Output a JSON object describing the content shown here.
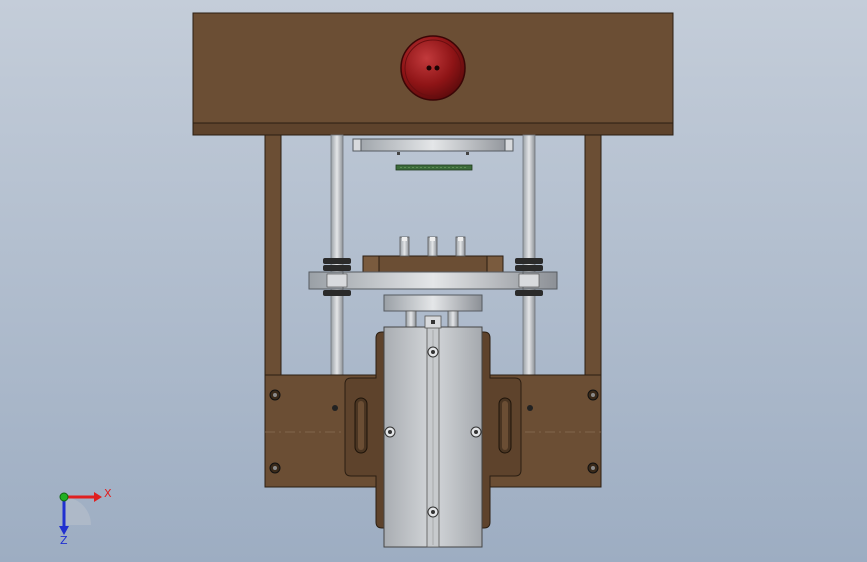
{
  "viewport": {
    "background_top": "#c4cdd9",
    "background_bottom": "#9dadc2"
  },
  "colors": {
    "wood": "#6b4e34",
    "wood_dark": "#4a3522",
    "metal": "#c9ccd0",
    "metal_dark": "#8c9096",
    "knob_red": "#8e1416",
    "pcb_green": "#3c6b3a",
    "axis_x": "#e02020",
    "axis_y": "#22b022",
    "axis_z": "#2030d0"
  },
  "triad": {
    "x_label": "X",
    "z_label": "Z"
  },
  "model": {
    "top_cap": "top-housing",
    "knob": "red-knob",
    "frame": "side-frame",
    "plate": "moving-plate",
    "slide": "linear-slide",
    "base": "base-mount"
  }
}
